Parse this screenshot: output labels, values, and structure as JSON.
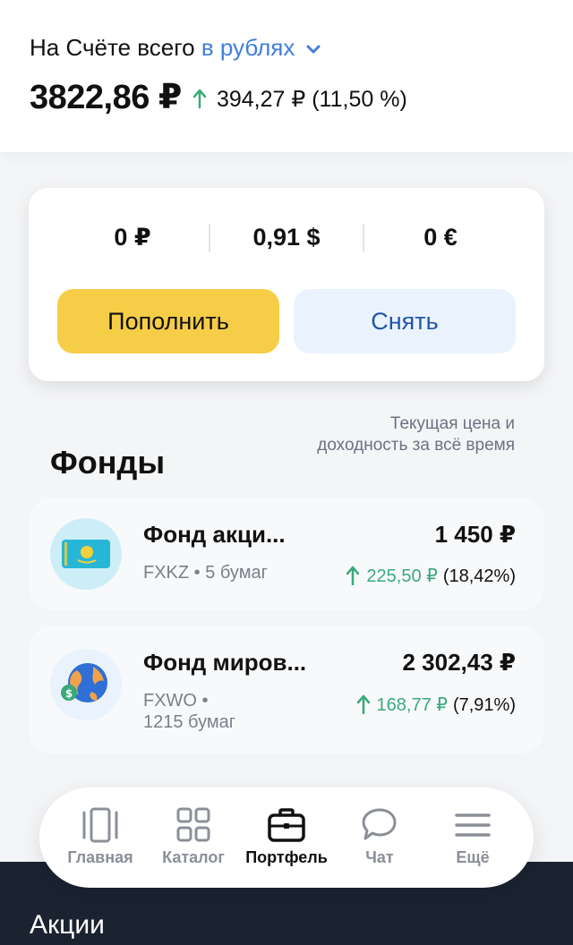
{
  "header": {
    "total_label": "На Счёте всего",
    "currency_selector": "в рублях",
    "total_amount": "3822,86 ₽",
    "total_change_abs": "394,27 ₽",
    "total_change_pct": "(11,50 %)"
  },
  "balances": {
    "rub": "0 ₽",
    "usd": "0,91 $",
    "eur": "0 €"
  },
  "actions": {
    "topup_label": "Пополнить",
    "withdraw_label": "Снять"
  },
  "funds": {
    "title": "Фонды",
    "hint": "Текущая цена и доходность за всё время",
    "items": [
      {
        "name": "Фонд акци...",
        "ticker": "FXKZ • 5 бумаг",
        "value": "1 450 ₽",
        "change_abs": "225,50 ₽",
        "change_pct": "(18,42%)",
        "icon": "kazakhstan-flag-icon"
      },
      {
        "name": "Фонд миров...",
        "ticker": "FXWO •\n1215 бумаг",
        "value": "2 302,43 ₽",
        "change_abs": "168,77 ₽",
        "change_pct": "(7,91%)",
        "icon": "globe-dollar-icon"
      }
    ]
  },
  "tabbar": {
    "items": [
      {
        "label": "Главная",
        "icon": "home-icon",
        "active": false
      },
      {
        "label": "Каталог",
        "icon": "grid-icon",
        "active": false
      },
      {
        "label": "Портфель",
        "icon": "briefcase-icon",
        "active": true
      },
      {
        "label": "Чат",
        "icon": "chat-icon",
        "active": false
      },
      {
        "label": "Ещё",
        "icon": "menu-icon",
        "active": false
      }
    ]
  },
  "next_section": {
    "label": "Акции"
  },
  "colors": {
    "accent_blue": "#3f7fdc",
    "positive_green": "#3aa97a",
    "topup_yellow": "#f6cd46",
    "withdraw_bg": "#eaf3fd",
    "dark_footer": "#1b2331"
  }
}
